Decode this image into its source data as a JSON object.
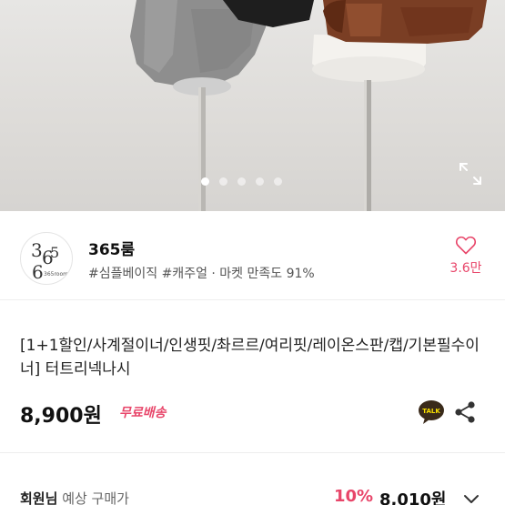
{
  "gallery": {
    "image_count": 5,
    "active_index": 0,
    "expand_icon": "expand-icon"
  },
  "shop": {
    "logo_icon": "shop-logo-365room",
    "logo_text": "365room",
    "name": "365룸",
    "tags": "#심플베이직 #캐주얼 · 마켓 만족도 91%",
    "like_icon": "heart-outline-icon",
    "like_count": "3.6만"
  },
  "product": {
    "title": "[1+1할인/사계절이너/인생핏/촤르르/여리핏/레이온스판/캡/기본필수이너] 터트리넥나시",
    "price": "8,900원",
    "shipping": "무료배송",
    "talk_icon": "kakaotalk-icon",
    "talk_label": "TALK",
    "share_icon": "share-icon"
  },
  "member_price": {
    "label": "회원님",
    "sub_label": "예상 구매가",
    "discount": "10%",
    "price": "8,010원",
    "chevron_icon": "chevron-down-icon"
  },
  "colors": {
    "accent_pink": "#e8466a",
    "text_dark": "#111111",
    "kakao_yellow": "#fae100"
  }
}
